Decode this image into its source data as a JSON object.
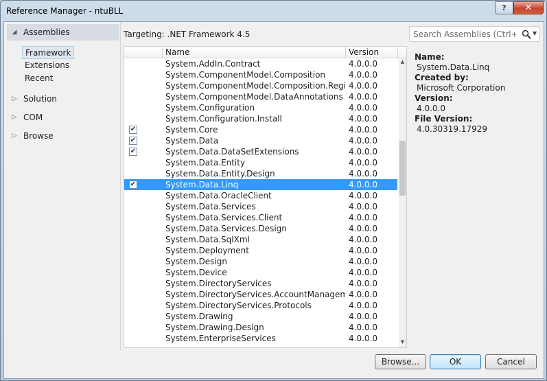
{
  "window": {
    "title": "Reference Manager - ntuBLL",
    "help_label": "?",
    "close_label": "✕"
  },
  "nav": {
    "sections": [
      {
        "label": "Assemblies",
        "arrow": "◢",
        "expanded": true,
        "selected": true
      },
      {
        "label": "Solution",
        "arrow": "▷",
        "expanded": false,
        "selected": false
      },
      {
        "label": "COM",
        "arrow": "▷",
        "expanded": false,
        "selected": false
      },
      {
        "label": "Browse",
        "arrow": "▷",
        "expanded": false,
        "selected": false
      }
    ],
    "assembly_items": [
      {
        "label": "Framework",
        "selected": true
      },
      {
        "label": "Extensions",
        "selected": false
      },
      {
        "label": "Recent",
        "selected": false
      }
    ]
  },
  "targeting": "Targeting: .NET Framework 4.5",
  "search": {
    "placeholder": "Search Assemblies (Ctrl+E)"
  },
  "list": {
    "columns": {
      "name": "Name",
      "version": "Version"
    },
    "rows": [
      {
        "name": "System.AddIn.Contract",
        "version": "4.0.0.0",
        "checked": false,
        "selected": false
      },
      {
        "name": "System.ComponentModel.Composition",
        "version": "4.0.0.0",
        "checked": false,
        "selected": false
      },
      {
        "name": "System.ComponentModel.Composition.Regist...",
        "version": "4.0.0.0",
        "checked": false,
        "selected": false
      },
      {
        "name": "System.ComponentModel.DataAnnotations",
        "version": "4.0.0.0",
        "checked": false,
        "selected": false
      },
      {
        "name": "System.Configuration",
        "version": "4.0.0.0",
        "checked": false,
        "selected": false
      },
      {
        "name": "System.Configuration.Install",
        "version": "4.0.0.0",
        "checked": false,
        "selected": false
      },
      {
        "name": "System.Core",
        "version": "4.0.0.0",
        "checked": true,
        "selected": false
      },
      {
        "name": "System.Data",
        "version": "4.0.0.0",
        "checked": true,
        "selected": false
      },
      {
        "name": "System.Data.DataSetExtensions",
        "version": "4.0.0.0",
        "checked": true,
        "selected": false
      },
      {
        "name": "System.Data.Entity",
        "version": "4.0.0.0",
        "checked": false,
        "selected": false
      },
      {
        "name": "System.Data.Entity.Design",
        "version": "4.0.0.0",
        "checked": false,
        "selected": false
      },
      {
        "name": "System.Data.Linq",
        "version": "4.0.0.0",
        "checked": true,
        "selected": true
      },
      {
        "name": "System.Data.OracleClient",
        "version": "4.0.0.0",
        "checked": false,
        "selected": false
      },
      {
        "name": "System.Data.Services",
        "version": "4.0.0.0",
        "checked": false,
        "selected": false
      },
      {
        "name": "System.Data.Services.Client",
        "version": "4.0.0.0",
        "checked": false,
        "selected": false
      },
      {
        "name": "System.Data.Services.Design",
        "version": "4.0.0.0",
        "checked": false,
        "selected": false
      },
      {
        "name": "System.Data.SqlXml",
        "version": "4.0.0.0",
        "checked": false,
        "selected": false
      },
      {
        "name": "System.Deployment",
        "version": "4.0.0.0",
        "checked": false,
        "selected": false
      },
      {
        "name": "System.Design",
        "version": "4.0.0.0",
        "checked": false,
        "selected": false
      },
      {
        "name": "System.Device",
        "version": "4.0.0.0",
        "checked": false,
        "selected": false
      },
      {
        "name": "System.DirectoryServices",
        "version": "4.0.0.0",
        "checked": false,
        "selected": false
      },
      {
        "name": "System.DirectoryServices.AccountManagement",
        "version": "4.0.0.0",
        "checked": false,
        "selected": false
      },
      {
        "name": "System.DirectoryServices.Protocols",
        "version": "4.0.0.0",
        "checked": false,
        "selected": false
      },
      {
        "name": "System.Drawing",
        "version": "4.0.0.0",
        "checked": false,
        "selected": false
      },
      {
        "name": "System.Drawing.Design",
        "version": "4.0.0.0",
        "checked": false,
        "selected": false
      },
      {
        "name": "System.EnterpriseServices",
        "version": "4.0.0.0",
        "checked": false,
        "selected": false
      }
    ]
  },
  "details": {
    "name_label": "Name:",
    "name_value": "System.Data.Linq",
    "created_label": "Created by:",
    "created_value": "Microsoft Corporation",
    "version_label": "Version:",
    "version_value": "4.0.0.0",
    "file_version_label": "File Version:",
    "file_version_value": "4.0.30319.17929"
  },
  "buttons": {
    "browse": "Browse...",
    "ok": "OK",
    "cancel": "Cancel"
  },
  "colors": {
    "selection": "#3399ff",
    "window_frame": "#bccde0",
    "close_button": "#c7432d"
  }
}
